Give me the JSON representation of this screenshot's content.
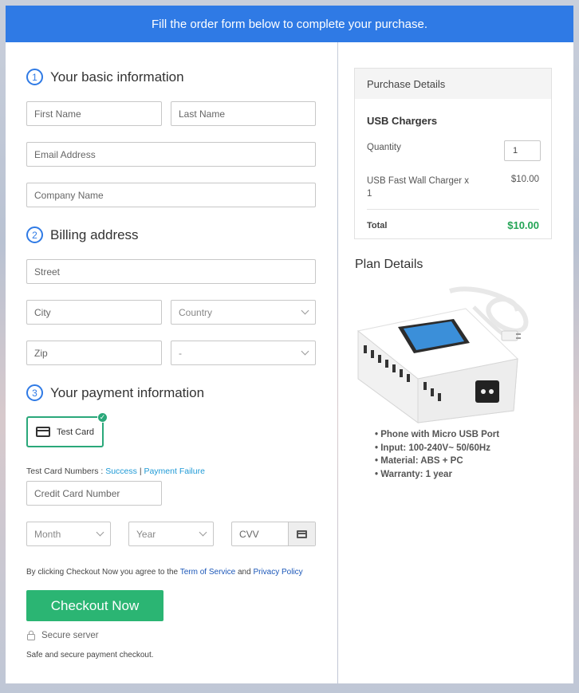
{
  "banner": {
    "text": "Fill the order form below to complete your purchase."
  },
  "basic": {
    "step": "1",
    "title": "Your basic information",
    "first_name": "First Name",
    "last_name": "Last Name",
    "email": "Email Address",
    "company": "Company Name"
  },
  "billing": {
    "step": "2",
    "title": "Billing address",
    "street": "Street",
    "city": "City",
    "country": "Country",
    "zip": "Zip",
    "state": "-"
  },
  "payment": {
    "step": "3",
    "title": "Your payment information",
    "card_option": "Test Card",
    "test_numbers_label": "Test Card Numbers :",
    "success_link": "Success",
    "separator": "|",
    "failure_link": "Payment Failure",
    "card_number": "Credit Card Number",
    "month": "Month",
    "year": "Year",
    "cvv": "CVV"
  },
  "terms": {
    "prefix": "By clicking Checkout Now you agree to the",
    "tos": "Term of Service",
    "and": "and",
    "privacy": "Privacy Policy"
  },
  "checkout": {
    "button": "Checkout Now",
    "secure": "Secure server",
    "note": "Safe and secure payment checkout."
  },
  "purchase": {
    "header": "Purchase Details",
    "product": "USB Chargers",
    "quantity_label": "Quantity",
    "quantity_value": "1",
    "line_item": "USB Fast Wall Charger x 1",
    "line_price": "$10.00",
    "total_label": "Total",
    "total_value": "$10.00"
  },
  "plan": {
    "title": "Plan Details",
    "features": [
      "Phone with Micro USB Port",
      "Input: 100-240V~ 50/60Hz",
      "Material: ABS + PC",
      "Warranty: 1 year"
    ]
  },
  "colors": {
    "accent": "#2f7ae5",
    "success": "#2bb573",
    "total_green": "#23a455"
  }
}
